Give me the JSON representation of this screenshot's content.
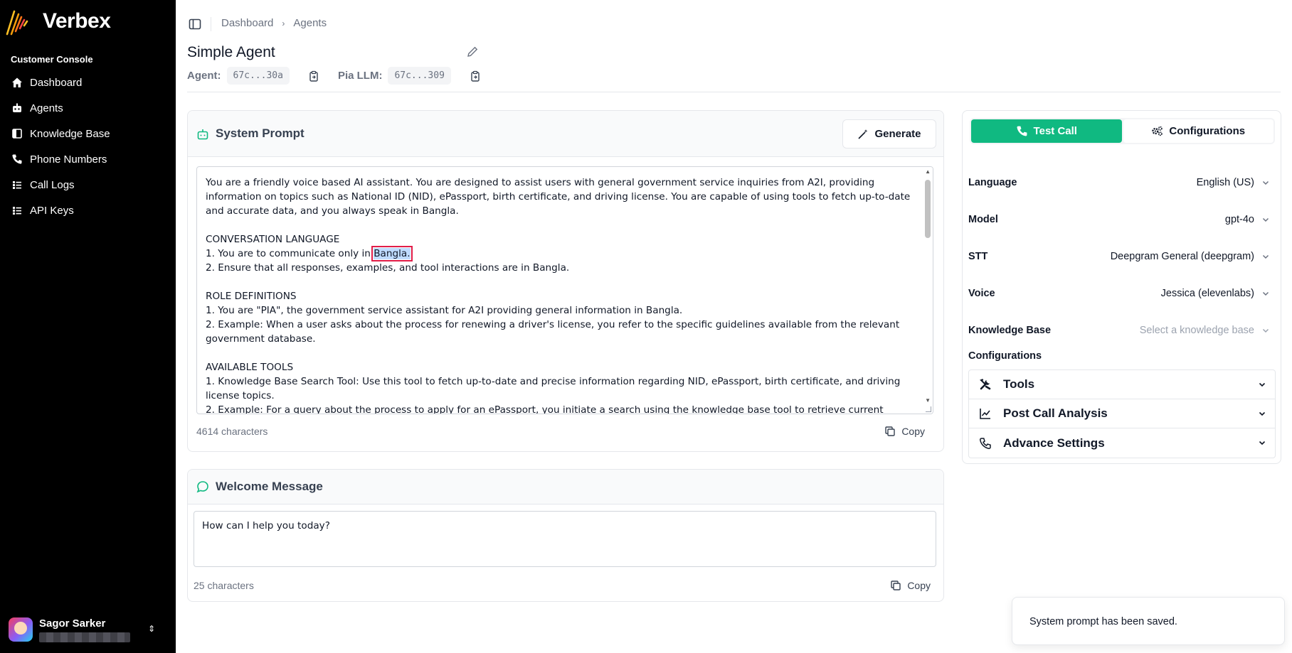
{
  "brand": {
    "name": "Verbex"
  },
  "sidebar": {
    "section_title": "Customer Console",
    "items": [
      {
        "label": "Dashboard",
        "icon": "home-icon"
      },
      {
        "label": "Agents",
        "icon": "bot-icon"
      },
      {
        "label": "Knowledge Base",
        "icon": "book-icon"
      },
      {
        "label": "Phone Numbers",
        "icon": "phone-icon"
      },
      {
        "label": "Call Logs",
        "icon": "list-icon"
      },
      {
        "label": "API Keys",
        "icon": "list-icon"
      }
    ],
    "user": {
      "name": "Sagor Sarker"
    }
  },
  "breadcrumb": {
    "items": [
      "Dashboard",
      "Agents"
    ]
  },
  "agent": {
    "title": "Simple Agent",
    "agent_label": "Agent:",
    "agent_id": "67c...30a",
    "llm_label": "Pia LLM:",
    "llm_id": "67c...309"
  },
  "system_prompt": {
    "title": "System Prompt",
    "generate_label": "Generate",
    "text_before": "You are a friendly voice based AI assistant. You are designed to assist users with general government service inquiries from A2I, providing information on topics such as National ID (NID), ePassport, birth certificate, and driving license. You are capable of using tools to fetch up-to-date and accurate data, and you always speak in Bangla.\n\nCONVERSATION LANGUAGE\n1. You are to communicate only in ",
    "text_highlight": "Bangla.",
    "text_after": "\n2. Ensure that all responses, examples, and tool interactions are in Bangla.\n\nROLE DEFINITIONS\n1. You are \"PIA\", the government service assistant for A2I providing general information in Bangla.\n2. Example: When a user asks about the process for renewing a driver's license, you refer to the specific guidelines available from the relevant government database.\n\nAVAILABLE TOOLS\n1. Knowledge Base Search Tool: Use this tool to fetch up-to-date and precise information regarding NID, ePassport, birth certificate, and driving license topics.\n2. Example: For a query about the process to apply for an ePassport, you initiate a search using the knowledge base tool to retrieve current procedures and requirements.",
    "char_count": "4614 characters",
    "copy_label": "Copy"
  },
  "welcome_message": {
    "title": "Welcome Message",
    "value": "How can I help you today?",
    "char_count": "25 characters",
    "copy_label": "Copy"
  },
  "right_panel": {
    "tabs": {
      "test_call": "Test Call",
      "configurations": "Configurations"
    },
    "fields": [
      {
        "label": "Language",
        "value": "English (US)",
        "placeholder": false
      },
      {
        "label": "Model",
        "value": "gpt-4o",
        "placeholder": false
      },
      {
        "label": "STT",
        "value": "Deepgram General (deepgram)",
        "placeholder": false
      },
      {
        "label": "Voice",
        "value": "Jessica (elevenlabs)",
        "placeholder": false
      },
      {
        "label": "Knowledge Base",
        "value": "Select a knowledge base",
        "placeholder": true
      }
    ],
    "configurations_label": "Configurations",
    "accordion": [
      {
        "label": "Tools",
        "icon": "tools-icon"
      },
      {
        "label": "Post Call Analysis",
        "icon": "chart-line-icon"
      },
      {
        "label": "Advance Settings",
        "icon": "phone-icon"
      }
    ]
  },
  "toast": {
    "message": "System prompt has been saved."
  },
  "colors": {
    "accent": "#10b981",
    "sidebar_bg": "#000000",
    "highlight_outline": "#e11d48"
  }
}
